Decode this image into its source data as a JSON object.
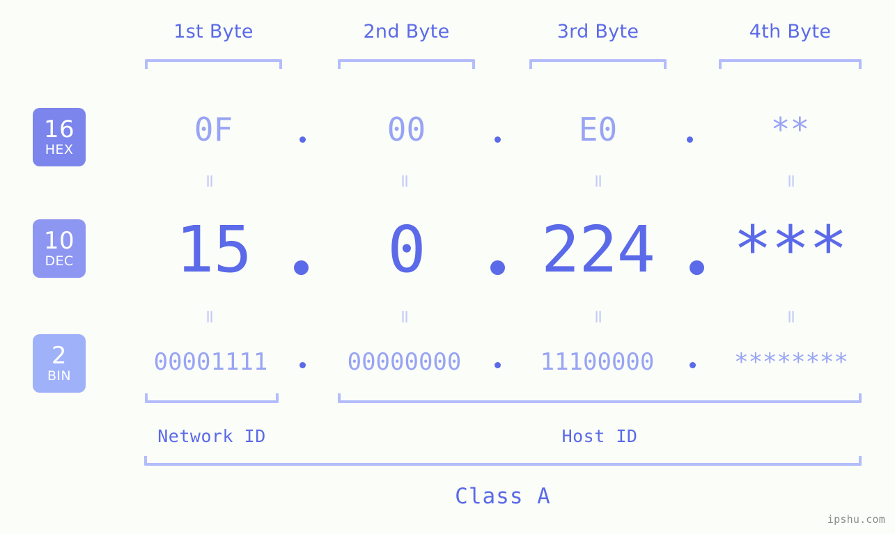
{
  "page": {
    "background_color": "#fbfdf8",
    "accent_color": "#5b6ae8",
    "light_accent_color": "#98a4f4",
    "bracket_color": "#b3bdfb",
    "watermark": "ipshu.com"
  },
  "byte_headers": [
    {
      "label": "1st Byte"
    },
    {
      "label": "2nd Byte"
    },
    {
      "label": "3rd Byte"
    },
    {
      "label": "4th Byte"
    }
  ],
  "bases": [
    {
      "number": "16",
      "name": "HEX",
      "color": "#7b85ec"
    },
    {
      "number": "10",
      "name": "DEC",
      "color": "#8d97f2"
    },
    {
      "number": "2",
      "name": "BIN",
      "color": "#9fb1f8"
    }
  ],
  "rows": {
    "hex": {
      "values": [
        "0F",
        "00",
        "E0",
        "**"
      ],
      "separator": "."
    },
    "dec": {
      "values": [
        "15",
        "0",
        "224",
        "***"
      ],
      "separator": "."
    },
    "bin": {
      "values": [
        "00001111",
        "00000000",
        "11100000",
        "********"
      ],
      "separator": "."
    }
  },
  "equals_symbol": "=",
  "id_labels": [
    {
      "label": "Network ID"
    },
    {
      "label": "Host ID"
    }
  ],
  "class_label": "Class A"
}
